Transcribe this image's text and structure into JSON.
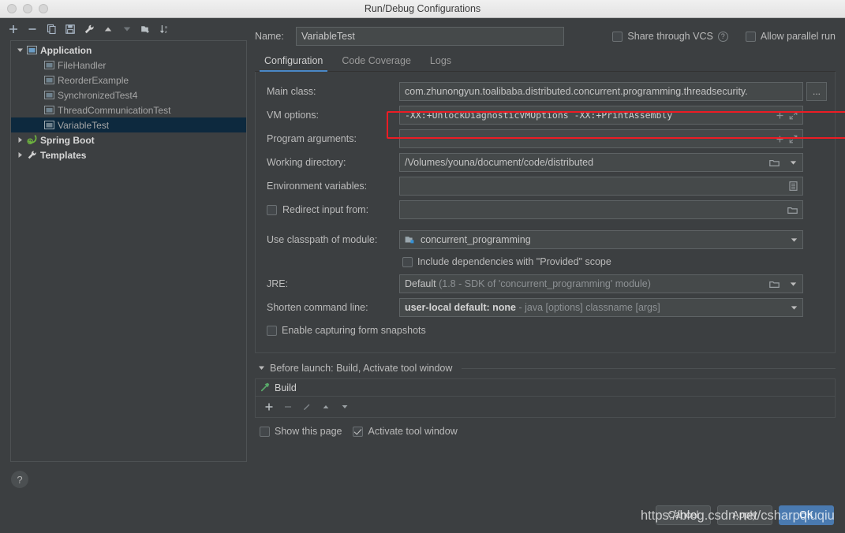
{
  "window": {
    "title": "Run/Debug Configurations"
  },
  "left_toolbar": {
    "buttons": [
      {
        "name": "add",
        "icon": "plus-icon"
      },
      {
        "name": "remove",
        "icon": "minus-icon"
      },
      {
        "name": "copy",
        "icon": "copy-icon"
      },
      {
        "name": "save",
        "icon": "save-icon"
      },
      {
        "name": "edit-templates",
        "icon": "wrench-icon"
      },
      {
        "name": "move-up",
        "icon": "arrow-up-icon"
      },
      {
        "name": "move-down",
        "icon": "arrow-down-icon"
      },
      {
        "name": "new-folder",
        "icon": "folder-add-icon"
      },
      {
        "name": "sort",
        "icon": "sort-alpha-icon"
      }
    ]
  },
  "tree": {
    "nodes": [
      {
        "label": "Application",
        "icon": "application-icon",
        "level": 0,
        "expanded": true,
        "bold": true,
        "selected": false
      },
      {
        "label": "FileHandler",
        "icon": "run-config-icon",
        "level": 1,
        "expanded": null,
        "bold": false,
        "selected": false
      },
      {
        "label": "ReorderExample",
        "icon": "run-config-icon",
        "level": 1,
        "expanded": null,
        "bold": false,
        "selected": false
      },
      {
        "label": "SynchronizedTest4",
        "icon": "run-config-icon",
        "level": 1,
        "expanded": null,
        "bold": false,
        "selected": false
      },
      {
        "label": "ThreadCommunicationTest",
        "icon": "run-config-icon",
        "level": 1,
        "expanded": null,
        "bold": false,
        "selected": false
      },
      {
        "label": "VariableTest",
        "icon": "run-config-icon",
        "level": 1,
        "expanded": null,
        "bold": false,
        "selected": true
      },
      {
        "label": "Spring Boot",
        "icon": "spring-boot-icon",
        "level": 0,
        "expanded": false,
        "bold": true,
        "selected": false
      },
      {
        "label": "Templates",
        "icon": "wrench-icon",
        "level": 0,
        "expanded": false,
        "bold": true,
        "selected": false
      }
    ]
  },
  "help": {
    "label": "?"
  },
  "name_row": {
    "label": "Name:",
    "value": "VariableTest",
    "share_vcs_label": "Share through VCS",
    "share_vcs_checked": false,
    "allow_parallel_label": "Allow parallel run",
    "allow_parallel_checked": false
  },
  "tabs": [
    {
      "label": "Configuration",
      "active": true
    },
    {
      "label": "Code Coverage",
      "active": false
    },
    {
      "label": "Logs",
      "active": false
    }
  ],
  "form": {
    "main_class": {
      "label": "Main class:",
      "value": "com.zhunongyun.toalibaba.distributed.concurrent.programming.threadsecurity.",
      "browse_label": "..."
    },
    "vm_options": {
      "label": "VM options:",
      "value": "-XX:+UnlockDiagnosticVMOptions -XX:+PrintAssembly",
      "highlighted": true
    },
    "program_arguments": {
      "label": "Program arguments:",
      "value": ""
    },
    "working_directory": {
      "label": "Working directory:",
      "value": "/Volumes/youna/document/code/distributed"
    },
    "environment_variables": {
      "label": "Environment variables:",
      "value": ""
    },
    "redirect_input": {
      "label": "Redirect input from:",
      "checked": false,
      "value": ""
    },
    "classpath_module": {
      "label": "Use classpath of module:",
      "value": "concurrent_programming"
    },
    "include_provided": {
      "label": "Include dependencies with \"Provided\" scope",
      "checked": false
    },
    "jre": {
      "label": "JRE:",
      "value": "Default",
      "hint": "(1.8 - SDK of 'concurrent_programming' module)"
    },
    "shorten_command_line": {
      "label": "Shorten command line:",
      "value": "user-local default: none",
      "hint": "- java [options] classname [args]"
    },
    "enable_form_snapshots": {
      "label": "Enable capturing form snapshots",
      "checked": false
    }
  },
  "before_launch": {
    "header": "Before launch: Build, Activate tool window",
    "items": [
      {
        "label": "Build",
        "icon": "build-hammer-icon"
      }
    ],
    "toolbar": [
      {
        "name": "add",
        "icon": "plus-icon",
        "enabled": true
      },
      {
        "name": "remove",
        "icon": "minus-icon",
        "enabled": false
      },
      {
        "name": "edit",
        "icon": "pencil-icon",
        "enabled": false
      },
      {
        "name": "move-up",
        "icon": "arrow-up-icon",
        "enabled": true
      },
      {
        "name": "move-down",
        "icon": "arrow-down-icon",
        "enabled": true
      }
    ],
    "show_this_page": {
      "label": "Show this page",
      "checked": false
    },
    "activate_tool_window": {
      "label": "Activate tool window",
      "checked": true
    }
  },
  "footer": {
    "cancel": "Cancel",
    "apply": "Apply",
    "ok": "OK"
  },
  "watermark": "https://blog.csdn.net/csharpqiuqiu",
  "colors": {
    "accent": "#4a88c7",
    "selection": "#0d293e",
    "highlight": "#ec1c24",
    "panel_bg": "#3c3f41",
    "field_bg": "#45494a"
  }
}
